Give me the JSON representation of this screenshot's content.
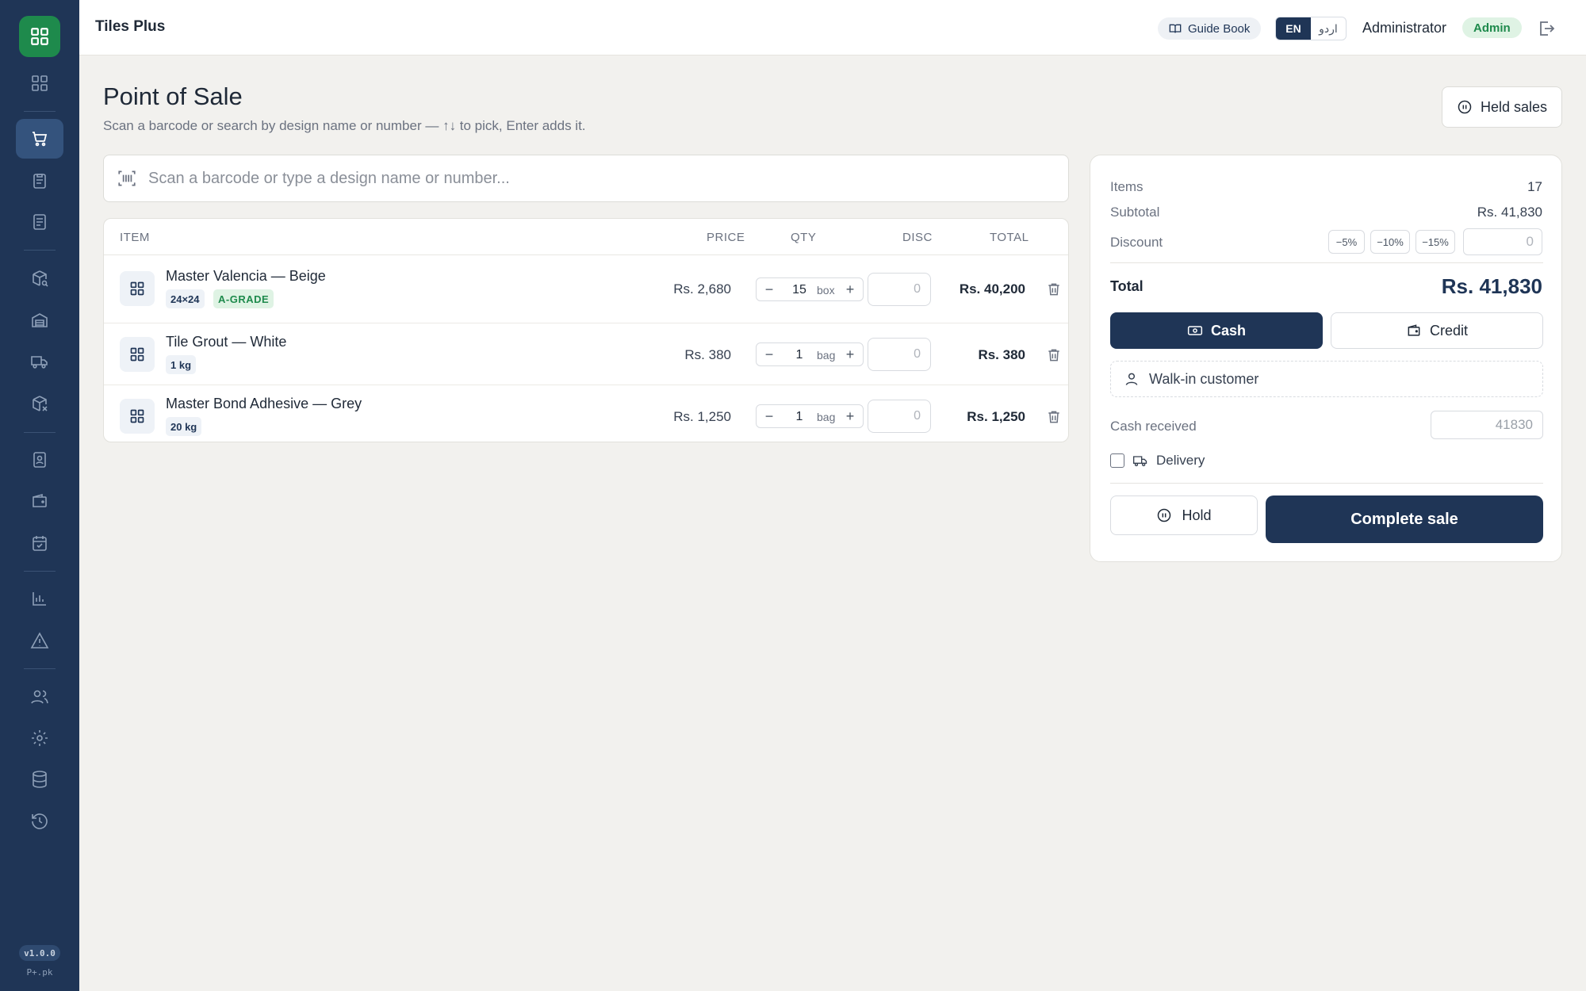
{
  "header": {
    "app_title": "Tiles Plus",
    "guide_label": "Guide Book",
    "lang_en": "EN",
    "lang_ur": "اردو",
    "user_name": "Administrator",
    "role": "Admin"
  },
  "sidebar": {
    "version": "v1.0.0",
    "brand": "P+.pk",
    "items": [
      {
        "icon": "dashboard-icon",
        "active": false
      },
      {
        "icon": "cart-icon",
        "active": true
      },
      {
        "icon": "clipboard-icon",
        "active": false
      },
      {
        "icon": "document-icon",
        "active": false
      },
      {
        "icon": "box-search-icon",
        "active": false
      },
      {
        "icon": "warehouse-icon",
        "active": false
      },
      {
        "icon": "truck-icon",
        "active": false
      },
      {
        "icon": "box-remove-icon",
        "active": false
      },
      {
        "icon": "contact-book-icon",
        "active": false
      },
      {
        "icon": "wallet-icon",
        "active": false
      },
      {
        "icon": "calendar-check-icon",
        "active": false
      },
      {
        "icon": "bar-chart-icon",
        "active": false
      },
      {
        "icon": "alert-icon",
        "active": false
      },
      {
        "icon": "users-icon",
        "active": false
      },
      {
        "icon": "gear-icon",
        "active": false
      },
      {
        "icon": "database-icon",
        "active": false
      },
      {
        "icon": "history-icon",
        "active": false
      }
    ]
  },
  "page": {
    "title": "Point of Sale",
    "subtitle": "Scan a barcode or search by design name or number — ↑↓ to pick, Enter adds it.",
    "held_sales_label": "Held sales"
  },
  "search": {
    "placeholder": "Scan a barcode or type a design name or number..."
  },
  "cart": {
    "columns": {
      "item": "ITEM",
      "price": "PRICE",
      "qty": "QTY",
      "disc": "DISC",
      "total": "TOTAL"
    },
    "rows": [
      {
        "name": "Master Valencia — Beige",
        "tags": [
          "24×24",
          "A-GRADE"
        ],
        "price": "Rs. 2,680",
        "qty": "15",
        "unit": "box",
        "disc": "0",
        "total": "Rs. 40,200"
      },
      {
        "name": "Tile Grout — White",
        "tags": [
          "1 kg"
        ],
        "price": "Rs. 380",
        "qty": "1",
        "unit": "bag",
        "disc": "0",
        "total": "Rs. 380"
      },
      {
        "name": "Master Bond Adhesive — Grey",
        "tags": [
          "20 kg"
        ],
        "price": "Rs. 1,250",
        "qty": "1",
        "unit": "bag",
        "disc": "0",
        "total": "Rs. 1,250"
      }
    ]
  },
  "summary": {
    "items_label": "Items",
    "items_value": "17",
    "subtotal_label": "Subtotal",
    "subtotal_value": "Rs. 41,830",
    "discount_label": "Discount",
    "discount_chips": [
      "−5%",
      "−10%",
      "−15%"
    ],
    "discount_value": "0",
    "total_label": "Total",
    "total_value": "Rs. 41,830",
    "pay_cash": "Cash",
    "pay_credit": "Credit",
    "customer": "Walk-in customer",
    "cash_received_label": "Cash received",
    "cash_received_value": "41830",
    "delivery_label": "Delivery",
    "hold_label": "Hold",
    "complete_label": "Complete sale"
  },
  "colors": {
    "sidebar": "#1f3556",
    "brand_green": "#1e8a4c",
    "primary": "#1f3556"
  }
}
